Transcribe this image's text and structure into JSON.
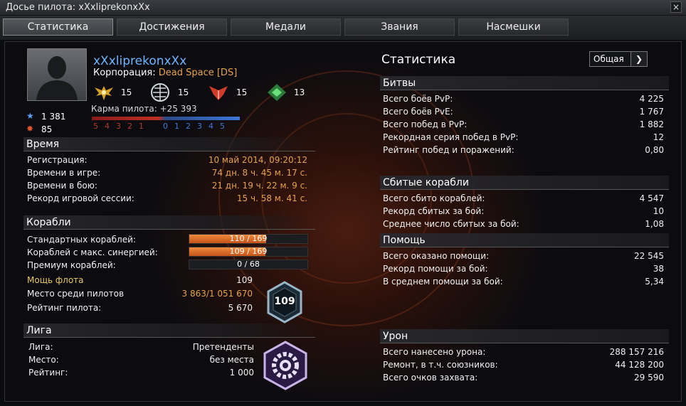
{
  "window": {
    "title": "Досье пилота: xXxliprekonxXx",
    "close": "×"
  },
  "tabs": [
    "Статистика",
    "Достижения",
    "Медали",
    "Звания",
    "Насмешки"
  ],
  "pilot": {
    "name": "xXxliprekonxXx",
    "corp_label": "Корпорация:",
    "corp": "Dead Space [DS]",
    "ranks": [
      "15",
      "15",
      "15",
      "13"
    ],
    "stars": "1 381",
    "skulls": "85",
    "karma_label": "Карма пилота:",
    "karma": "+25 393",
    "karma_scale_neg": [
      "5",
      "4",
      "3",
      "2",
      "1"
    ],
    "karma_scale_pos": [
      "0",
      "1",
      "2",
      "3",
      "4",
      "5"
    ]
  },
  "time": {
    "header": "Время",
    "rows": [
      {
        "label": "Регистрация:",
        "value": "10 май 2014, 09:20:12"
      },
      {
        "label": "Времени в игре:",
        "value": "74 дн. 8 ч. 45 м. 17 с."
      },
      {
        "label": "Времени в бою:",
        "value": "21 дн. 19 ч. 22 м. 9 с."
      },
      {
        "label": "Рекорд игровой сессии:",
        "value": "15 ч. 58 м. 41 с."
      }
    ]
  },
  "ships": {
    "header": "Корабли",
    "standard_label": "Стандартных кораблей:",
    "standard": "110 / 169",
    "standard_fraction": 0.651,
    "synergy_label": "Кораблей с макс. синергией:",
    "synergy": "109 / 169",
    "synergy_fraction": 0.645,
    "premium_label": "Премиум кораблей:",
    "premium": "0 / 68",
    "fleet_label": "Мощь флота",
    "fleet": "109",
    "place_label": "Место среди пилотов",
    "place_a": "3 863",
    "place_b": "/1 051 670",
    "rating_label": "Рейтинг пилота:",
    "rating": "5 670",
    "badge": "109"
  },
  "league": {
    "header": "Лига",
    "rows": [
      {
        "label": "Лига:",
        "value": "Претенденты"
      },
      {
        "label": "Место:",
        "value": "без места"
      },
      {
        "label": "Рейтинг:",
        "value": "1 000"
      }
    ]
  },
  "stats": {
    "title": "Статистика",
    "dropdown": "Общая",
    "battles": {
      "header": "Битвы",
      "rows": [
        {
          "label": "Всего боёв PvP:",
          "value": "4 225"
        },
        {
          "label": "Всего боёв PvE:",
          "value": "1 767"
        },
        {
          "label": "Всего побед в PvP:",
          "value": "1 882"
        },
        {
          "label": "Рекордная серия побед в PvP:",
          "value": "12"
        },
        {
          "label": "Рейтинг побед и поражений:",
          "value": "0,80"
        }
      ]
    },
    "kills": {
      "header": "Сбитые корабли",
      "rows": [
        {
          "label": "Всего сбито кораблей:",
          "value": "4 547"
        },
        {
          "label": "Рекорд сбитых за бой:",
          "value": "10"
        },
        {
          "label": "Среднее число сбитых за бой:",
          "value": "1,08"
        }
      ]
    },
    "assists": {
      "header": "Помощь",
      "rows": [
        {
          "label": "Всего оказано помощи:",
          "value": "22 545"
        },
        {
          "label": "Рекорд помощи за бой:",
          "value": "38"
        },
        {
          "label": "В среднем помощи за бой:",
          "value": "5,34"
        }
      ]
    },
    "damage": {
      "header": "Урон",
      "rows": [
        {
          "label": "Всего нанесено урона:",
          "value": "288 157 216"
        },
        {
          "label": "Ремонт, в т.ч. союзников:",
          "value": "44 128 200"
        },
        {
          "label": "Всего очков захвата:",
          "value": "29 590"
        }
      ]
    }
  }
}
